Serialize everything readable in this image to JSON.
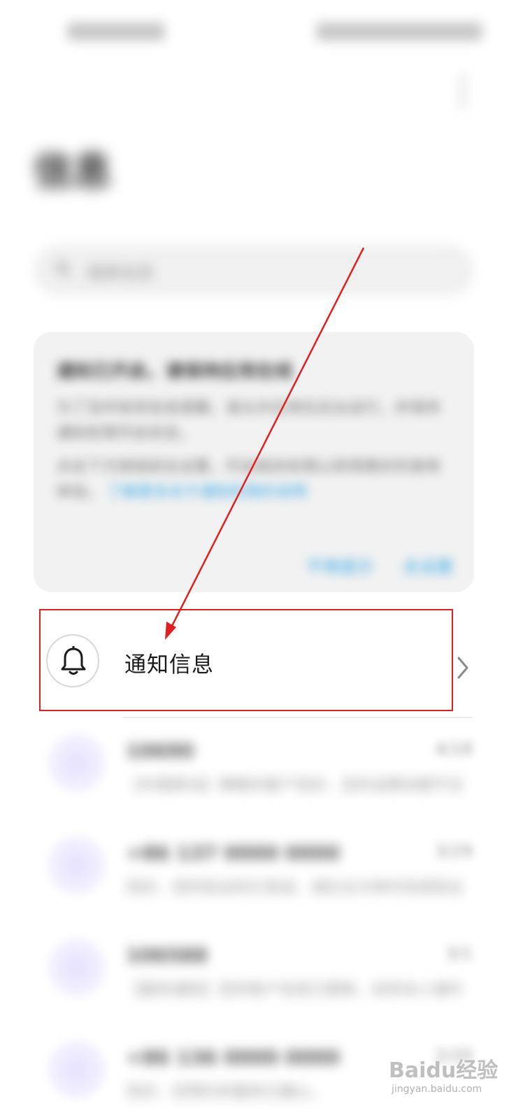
{
  "page": {
    "title": "信息"
  },
  "search": {
    "placeholder": "搜索信息"
  },
  "banner": {
    "title": "通知已开启，请保持应用在线",
    "text": "为了及时收到信息提醒，请允许应用在后台运行，并保持通知权限开启状态。",
    "text2": "点击下方按钮前往设置，开启相关权限以获得更好的使用体验。",
    "link": "了解更多关于通知权限的说明",
    "btn_secondary": "不再提示",
    "btn_primary": "去设置"
  },
  "notification": {
    "label": "通知信息",
    "icon": "bell-icon"
  },
  "messages": [
    {
      "name": "10690",
      "time": "4/18",
      "preview": "【中国移动】尊敬的客户您好，您的话费余额不足请及时充值。"
    },
    {
      "name": "+86 137 0000 0000",
      "time": "3/29",
      "preview": "您好，您的验证码已发送，请在五分钟内完成验证操作。"
    },
    {
      "name": "106588",
      "time": "3/1",
      "preview": "【服务通知】您的账户信息已更新，如非本人操作请联系客服。"
    },
    {
      "name": "+86 136 0000 0000",
      "time": "2/20",
      "preview": "您好，您预约的服务已确认。"
    }
  ],
  "watermark": {
    "main": "Baidu经验",
    "sub": "jingyan.baidu.com"
  },
  "colors": {
    "annotation": "#e02020",
    "link": "#39a8e6"
  }
}
